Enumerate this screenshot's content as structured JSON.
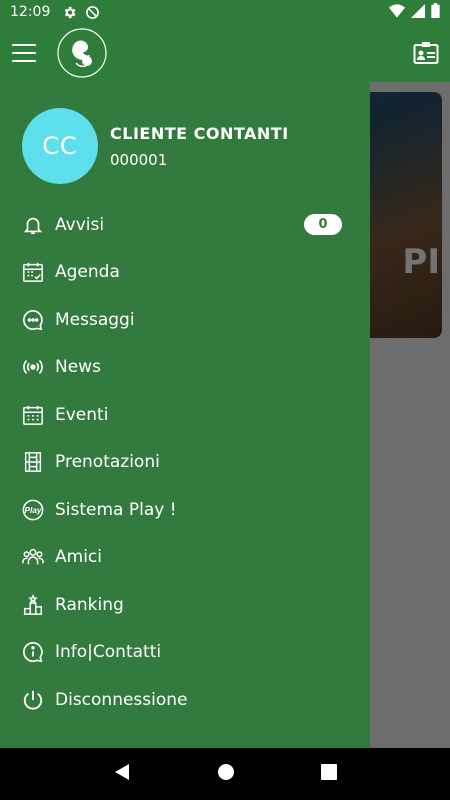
{
  "status": {
    "time": "12:09"
  },
  "profile": {
    "initials": "CC",
    "name": "CLIENTE CONTANTI",
    "code": "000001"
  },
  "menu": [
    {
      "label": "Avvisi",
      "icon": "bell-icon",
      "badge": "0"
    },
    {
      "label": "Agenda",
      "icon": "calendar-check-icon"
    },
    {
      "label": "Messaggi",
      "icon": "chat-bubble-icon"
    },
    {
      "label": "News",
      "icon": "broadcast-icon"
    },
    {
      "label": "Eventi",
      "icon": "calendar-grid-icon"
    },
    {
      "label": "Prenotazioni",
      "icon": "court-icon"
    },
    {
      "label": "Sistema Play !",
      "icon": "play-logo-icon"
    },
    {
      "label": "Amici",
      "icon": "group-icon"
    },
    {
      "label": "Ranking",
      "icon": "podium-icon"
    },
    {
      "label": "Info|Contatti",
      "icon": "info-icon"
    },
    {
      "label": "Disconnessione",
      "icon": "power-icon"
    }
  ],
  "background": {
    "card_text": "PI"
  },
  "colors": {
    "primary": "#2e7d3a",
    "drawer": "#337a3e",
    "avatar": "#5de0ec"
  }
}
